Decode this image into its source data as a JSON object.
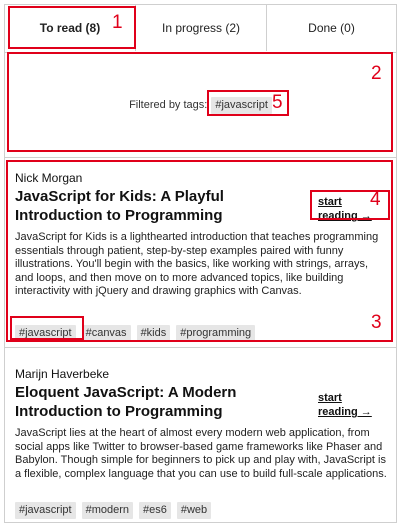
{
  "tabs": [
    {
      "label": "To read (8)"
    },
    {
      "label": "In progress (2)"
    },
    {
      "label": "Done (0)"
    }
  ],
  "filter": {
    "label": "Filtered by tags:",
    "tag": "#javascript"
  },
  "books": [
    {
      "author": "Nick Morgan",
      "title": "JavaScript for Kids: A Playful Introduction to Programming",
      "action": "start reading →",
      "description": "JavaScript for Kids is a lighthearted introduction that teaches programming essentials through patient, step-by-step examples paired with funny illustrations. You'll begin with the basics, like working with strings, arrays, and loops, and then move on to more advanced topics, like building interactivity with jQuery and drawing graphics with Canvas.",
      "tags": [
        "#javascript",
        "#canvas",
        "#kids",
        "#programming"
      ]
    },
    {
      "author": "Marijn Haverbeke",
      "title": "Eloquent JavaScript: A Modern Introduction to Programming",
      "action": "start reading →",
      "description": "JavaScript lies at the heart of almost every modern web application, from social apps like Twitter to browser-based game frameworks like Phaser and Babylon. Though simple for beginners to pick up and play with, JavaScript is a flexible, complex language that you can use to build full-scale applications.",
      "tags": [
        "#javascript",
        "#modern",
        "#es6",
        "#web"
      ]
    }
  ],
  "annotations": {
    "n1": "1",
    "n2": "2",
    "n3": "3",
    "n4": "4",
    "n5": "5",
    "color": "#e0001a"
  }
}
